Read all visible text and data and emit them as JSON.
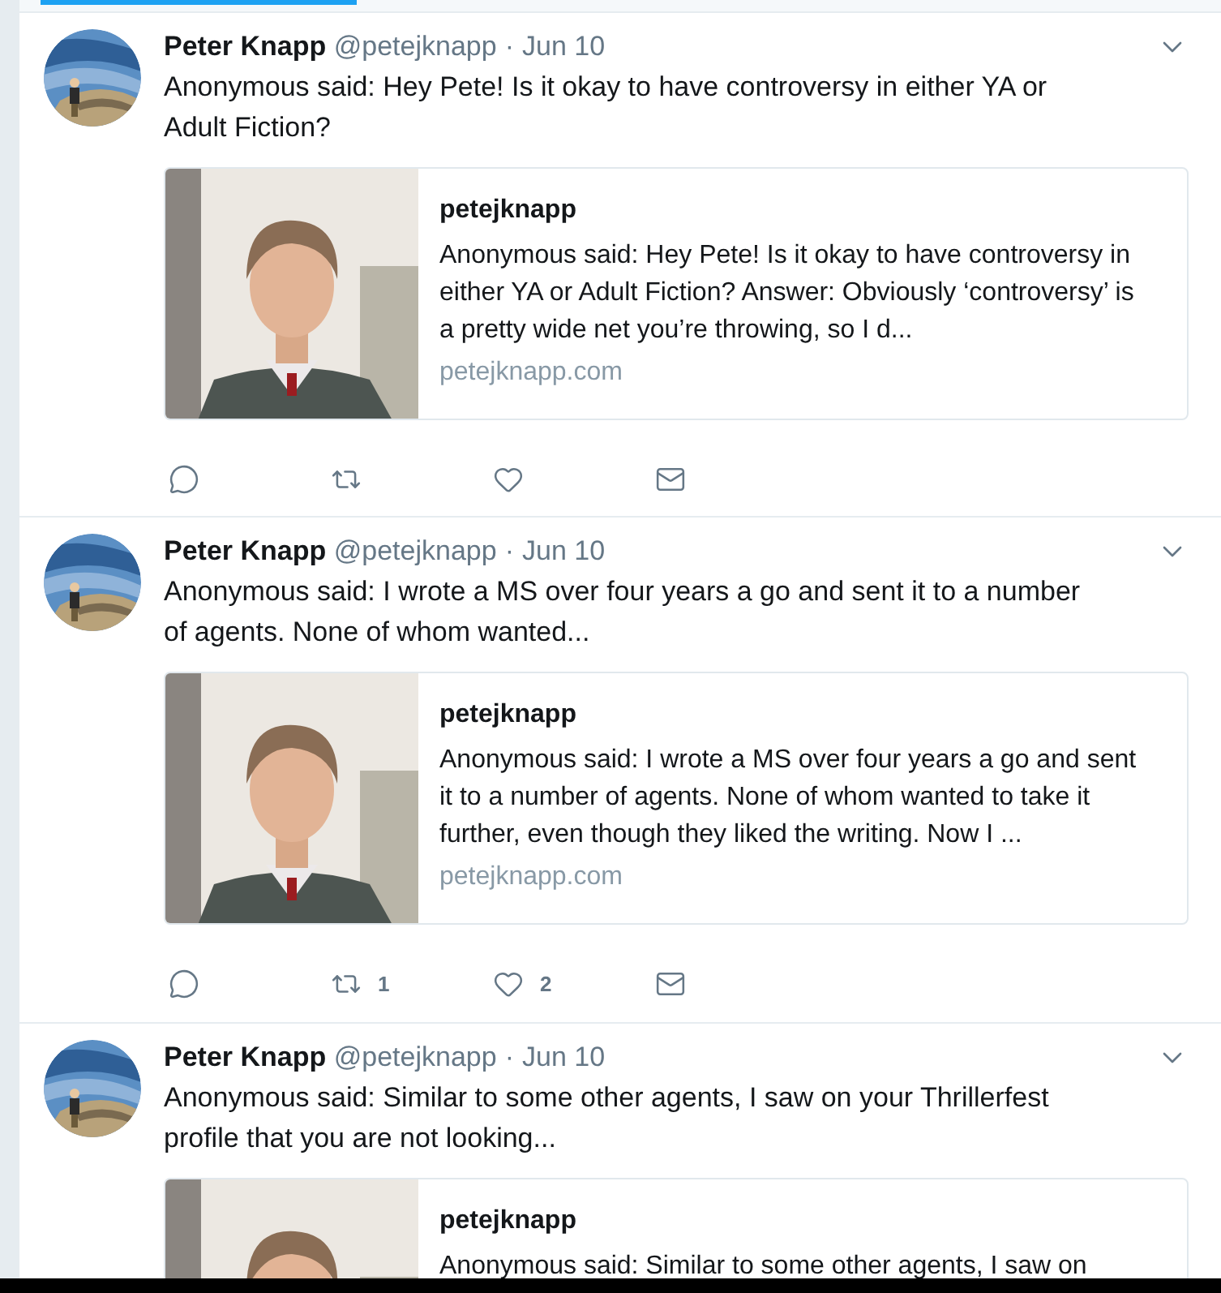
{
  "tweets": [
    {
      "name": "Peter Knapp",
      "handle": "@petejknapp",
      "separator": "·",
      "date": "Jun 10",
      "text": "Anonymous said: Hey Pete! Is it okay to have controversy in either YA or Adult Fiction?",
      "card": {
        "title": "petejknapp",
        "text": "Anonymous said: Hey Pete! Is it okay to have controversy in either YA or Adult Fiction? Answer: Obviously ‘controversy’ is a pretty wide net you’re throwing, so I d...",
        "domain": "petejknapp.com"
      },
      "actions": [
        {
          "kind": "reply"
        },
        {
          "kind": "retweet"
        },
        {
          "kind": "like"
        },
        {
          "kind": "message"
        }
      ]
    },
    {
      "name": "Peter Knapp",
      "handle": "@petejknapp",
      "separator": "·",
      "date": "Jun 10",
      "text": "Anonymous said: I wrote a MS over four years a go and sent it to a number of agents. None of whom wanted...",
      "card": {
        "title": "petejknapp",
        "text": "Anonymous said: I wrote a MS over four years a go and sent it to a number of agents. None of whom wanted to take it further, even though they liked the writing. Now I ...",
        "domain": "petejknapp.com"
      },
      "actions": [
        {
          "kind": "reply"
        },
        {
          "kind": "retweet",
          "count": "1"
        },
        {
          "kind": "like",
          "count": "2"
        },
        {
          "kind": "message"
        }
      ]
    },
    {
      "name": "Peter Knapp",
      "handle": "@petejknapp",
      "separator": "·",
      "date": "Jun 10",
      "text": "Anonymous said: Similar to some other agents, I saw on your Thrillerfest profile that you are not looking...",
      "card": {
        "title": "petejknapp",
        "text": "Anonymous said: Similar to some other agents, I saw on"
      }
    }
  ]
}
